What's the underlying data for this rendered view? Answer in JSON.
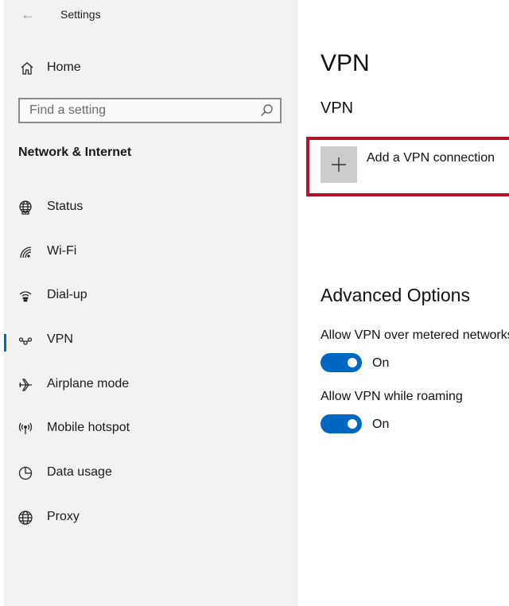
{
  "app": {
    "title": "Settings",
    "back_icon": "arrow-left-icon"
  },
  "sidebar": {
    "home_label": "Home",
    "search": {
      "placeholder": "Find a setting"
    },
    "section_heading": "Network & Internet",
    "items": [
      {
        "label": "Status",
        "icon": "globe-network-icon",
        "active": false
      },
      {
        "label": "Wi-Fi",
        "icon": "wifi-icon",
        "active": false
      },
      {
        "label": "Dial-up",
        "icon": "dialup-icon",
        "active": false
      },
      {
        "label": "VPN",
        "icon": "vpn-icon",
        "active": true
      },
      {
        "label": "Airplane mode",
        "icon": "airplane-icon",
        "active": false
      },
      {
        "label": "Mobile hotspot",
        "icon": "hotspot-icon",
        "active": false
      },
      {
        "label": "Data usage",
        "icon": "data-usage-icon",
        "active": false
      },
      {
        "label": "Proxy",
        "icon": "globe-icon",
        "active": false
      }
    ]
  },
  "main": {
    "page_title": "VPN",
    "sub_title": "VPN",
    "add_vpn_label": "Add a VPN connection",
    "advanced_title": "Advanced Options",
    "options": [
      {
        "label": "Allow VPN over metered networks",
        "state": "On"
      },
      {
        "label": "Allow VPN while roaming",
        "state": "On"
      }
    ]
  },
  "colors": {
    "accent": "#0067c0",
    "highlight_border": "#b5122a",
    "sidebar_bg": "#f2f2f2"
  }
}
